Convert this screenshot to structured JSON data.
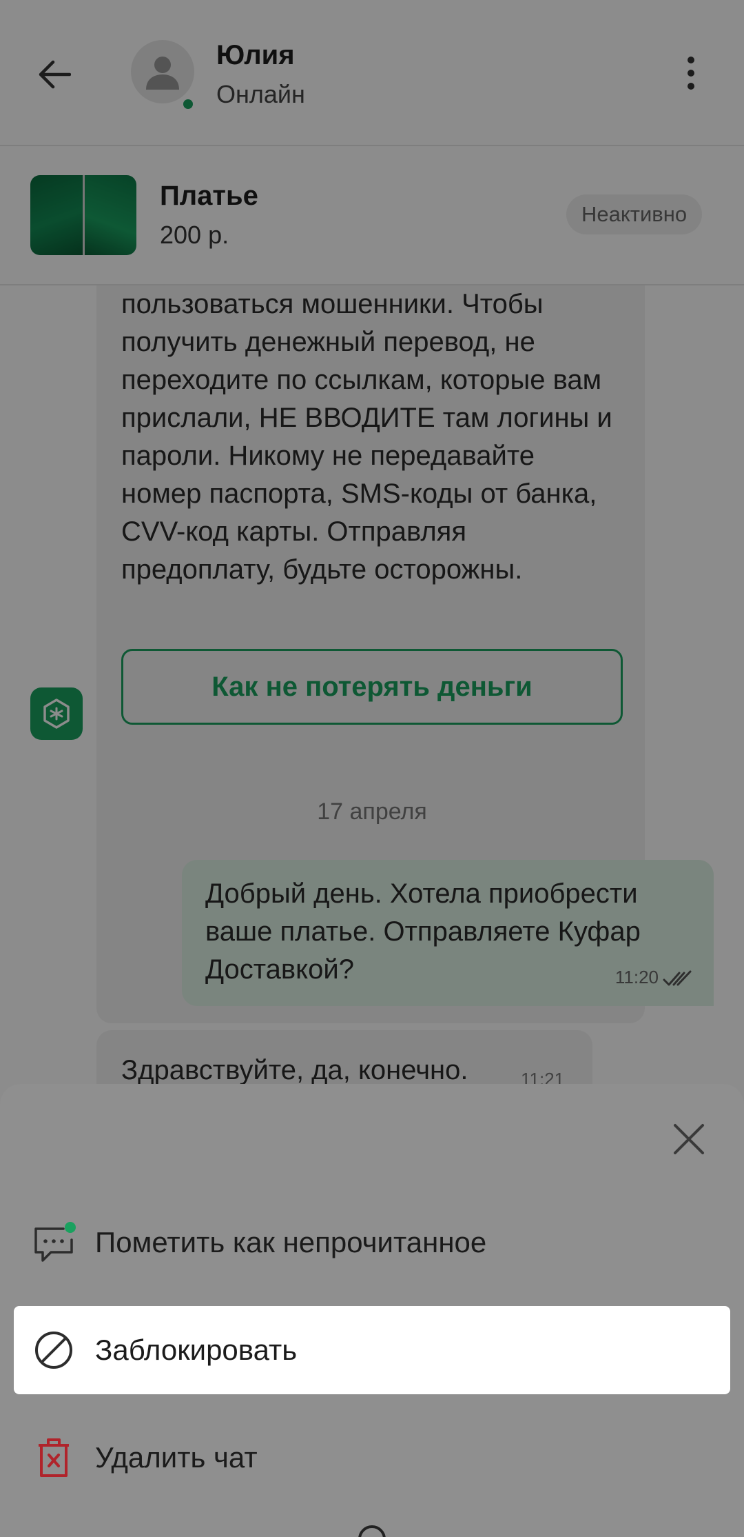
{
  "header": {
    "contact_name": "Юлия",
    "contact_status": "Онлайн"
  },
  "listing": {
    "title": "Платье",
    "price": "200 р.",
    "status": "Неактивно"
  },
  "messages": {
    "system_text": "пользоваться мошенники. Чтобы получить денежный перевод, не переходите по ссылкам, которые вам прислали, НЕ ВВОДИТЕ там логины и пароли. Никому не передавайте номер паспорта, SMS-коды от банка, CVV-код карты. Отправляя предоплату, будьте осторожны.",
    "system_button": "Как не потерять деньги",
    "date_separator": "17 апреля",
    "outgoing": {
      "text": "Добрый день. Хотела приобрести ваше платье. Отправляете Куфар Доставкой?",
      "time": "11:20"
    },
    "incoming": {
      "text": "Здравствуйте, да, конечно.",
      "time": "11:21"
    }
  },
  "sheet": {
    "items": [
      {
        "label": "Пометить как непрочитанное",
        "icon": "mark-unread-icon"
      },
      {
        "label": "Заблокировать",
        "icon": "block-icon"
      },
      {
        "label": "Удалить чат",
        "icon": "trash-icon"
      }
    ]
  },
  "colors": {
    "accent_green": "#1aa15f",
    "delete_red": "#b0242b",
    "overlay": "rgba(0,0,0,0.45)"
  }
}
